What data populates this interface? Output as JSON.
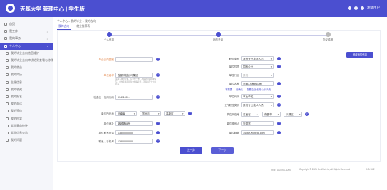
{
  "header": {
    "title": "天基大学 管理中心  | 学生版",
    "user": "测试用户"
  },
  "sidebar": {
    "items": [
      {
        "label": "首页"
      },
      {
        "label": "我工作",
        "arrow": ">"
      },
      {
        "label": "我的事务",
        "arrow": ">"
      },
      {
        "label": "个人中心",
        "arrow": "v"
      },
      {
        "label": "我的毕业去向信息维护"
      },
      {
        "label": "我的毕业去向审核结果查看与修改管理"
      },
      {
        "label": "我的就业"
      },
      {
        "label": "我的简历"
      },
      {
        "label": "生源信息"
      },
      {
        "label": "我的收藏"
      },
      {
        "label": "我的报名"
      },
      {
        "label": "我的面试"
      },
      {
        "label": "我的签约"
      },
      {
        "label": "我的档案"
      },
      {
        "label": "就业意向统计"
      },
      {
        "label": "就业信息公告"
      },
      {
        "label": "我的问题"
      }
    ]
  },
  "breadcrumb": "个人中心 > 我的毕业 > 我的去向",
  "tabs": [
    {
      "label": "我的去向"
    },
    {
      "label": "就业推荐表"
    }
  ],
  "steps": [
    {
      "label": "个人信息"
    },
    {
      "label": "我的去向"
    },
    {
      "label": "协议填报"
    }
  ],
  "form": {
    "left": {
      "destination_label": "毕业去向类别",
      "unit_label": "单位名称",
      "unit_value": "首都科技公司集团",
      "unit_note": "请填写单位全称，与公章一致，不得使用简称或缩写；单位名称不得包含特殊字符，不得填写个人姓名等",
      "credit_label": "社会统一信用代码",
      "credit_value": "9141100...",
      "location_label": "单位所在地",
      "loc1": "河南省",
      "loc2": "郑州市",
      "loc3": "高新区",
      "address_label": "单位地址",
      "address_value": "新城路88号",
      "phone_label": "单位联系电话",
      "phone_value": "13800000000",
      "contact_phone_label": "联系人手机号",
      "contact_phone_value": "13800000000"
    },
    "right": {
      "jobtype_label": "职业类别",
      "jobtype_value": "其他专业技术人员",
      "nature_label": "单位性质",
      "nature_value": "国有企业",
      "industry_label": "单位行业",
      "industry_value": "其他",
      "unitname_label": "单位名称",
      "unitname_value": "河南XX有限公司",
      "links": [
        "不需要",
        "已确认",
        "查看企业信用公示系统"
      ],
      "reg_label": "单位代码",
      "reg_value": "事业单位",
      "job_label": "工作职位类别",
      "job_value": "其他专业技术人员",
      "loc_label": "单位所在地",
      "loc1": "江西省",
      "loc2": "南昌市",
      "loc3": "东湖区",
      "contact_label": "单位联系人",
      "contact_value": "张同学",
      "email_label": "单位邮箱",
      "email_value": "1456XXX@qq.com"
    },
    "edit_button": "修改我的信息"
  },
  "buttons": {
    "prev": "上一步",
    "next": "下一步"
  },
  "footer": {
    "phone": "电话: 400-001-1000",
    "copyright": "Copyright © 2021 GetWork.io, All Rights Reserved",
    "version": "1.3.16.2"
  }
}
